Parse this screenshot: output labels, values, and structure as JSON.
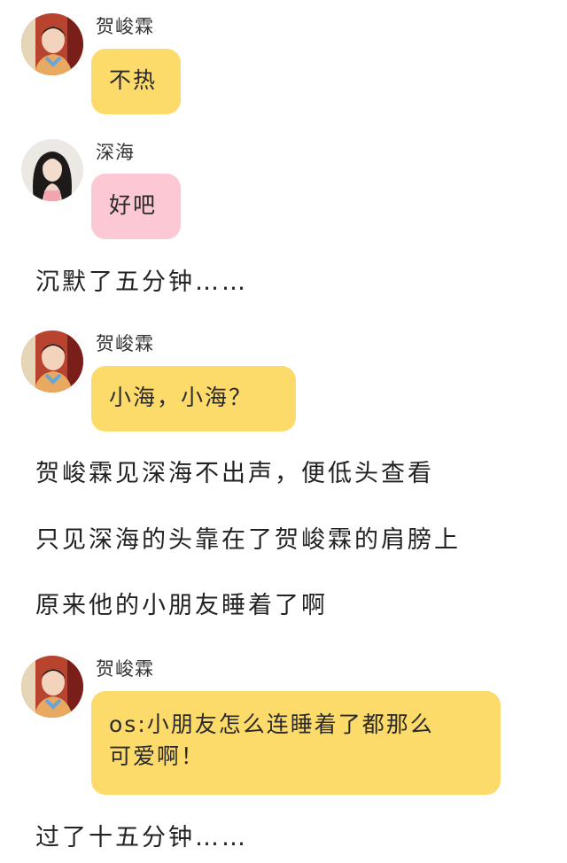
{
  "colors": {
    "bubble_yellow": "#FDDB6A",
    "bubble_pink": "#FBC8D4",
    "background": "#FFFFFF",
    "text": "#222222"
  },
  "messages": [
    {
      "speaker": "贺峻霖",
      "text": "不热",
      "bubble_color": "yellow",
      "avatar": "boy-avatar"
    },
    {
      "speaker": "深海",
      "text": "好吧",
      "bubble_color": "pink",
      "avatar": "girl-avatar"
    },
    {
      "speaker": "贺峻霖",
      "text": "小海，小海？",
      "bubble_color": "yellow",
      "avatar": "boy-avatar"
    },
    {
      "speaker": "贺峻霖",
      "text_line1": "os:小朋友怎么连睡着了都那么",
      "text_line2": "可爱啊！",
      "bubble_color": "yellow",
      "avatar": "boy-avatar"
    }
  ],
  "narration": [
    "沉默了五分钟……",
    "贺峻霖见深海不出声，便低头查看",
    "只见深海的头靠在了贺峻霖的肩膀上",
    "原来他的小朋友睡着了啊",
    "过了十五分钟……"
  ]
}
